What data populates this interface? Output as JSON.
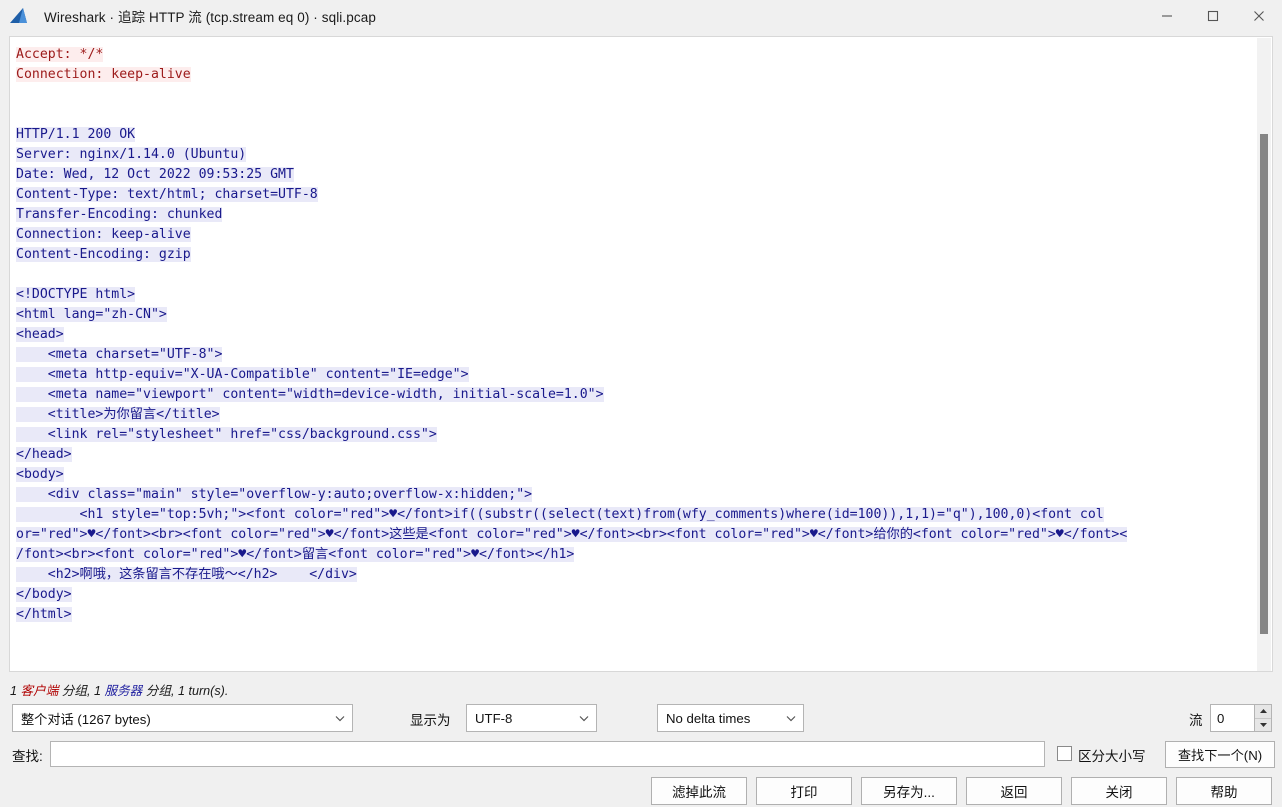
{
  "window": {
    "title": "Wireshark · 追踪 HTTP 流 (tcp.stream eq 0) · sqli.pcap",
    "logo_icon": "wireshark-shark-fin-logo",
    "minimize_icon": "minimize-icon",
    "maximize_icon": "maximize-icon",
    "close_icon": "close-icon"
  },
  "stream": {
    "lines": [
      {
        "dir": "req",
        "text": "Accept: */*"
      },
      {
        "dir": "req",
        "text": "Connection: keep-alive"
      },
      {
        "dir": "blank",
        "text": ""
      },
      {
        "dir": "blank",
        "text": ""
      },
      {
        "dir": "resp",
        "text": "HTTP/1.1 200 OK"
      },
      {
        "dir": "resp",
        "text": "Server: nginx/1.14.0 (Ubuntu)"
      },
      {
        "dir": "resp",
        "text": "Date: Wed, 12 Oct 2022 09:53:25 GMT"
      },
      {
        "dir": "resp",
        "text": "Content-Type: text/html; charset=UTF-8"
      },
      {
        "dir": "resp",
        "text": "Transfer-Encoding: chunked"
      },
      {
        "dir": "resp",
        "text": "Connection: keep-alive"
      },
      {
        "dir": "resp",
        "text": "Content-Encoding: gzip"
      },
      {
        "dir": "blank",
        "text": ""
      },
      {
        "dir": "resp",
        "text": "<!DOCTYPE html>"
      },
      {
        "dir": "resp",
        "text": "<html lang=\"zh-CN\">"
      },
      {
        "dir": "resp",
        "text": "<head>"
      },
      {
        "dir": "resp",
        "text": "    <meta charset=\"UTF-8\">"
      },
      {
        "dir": "resp",
        "text": "    <meta http-equiv=\"X-UA-Compatible\" content=\"IE=edge\">"
      },
      {
        "dir": "resp",
        "text": "    <meta name=\"viewport\" content=\"width=device-width, initial-scale=1.0\">"
      },
      {
        "dir": "resp",
        "text": "    <title>为你留言</title>"
      },
      {
        "dir": "resp",
        "text": "    <link rel=\"stylesheet\" href=\"css/background.css\">"
      },
      {
        "dir": "resp",
        "text": "</head>"
      },
      {
        "dir": "resp",
        "text": "<body>"
      },
      {
        "dir": "resp",
        "text": "    <div class=\"main\" style=\"overflow-y:auto;overflow-x:hidden;\">"
      },
      {
        "dir": "resp",
        "text": "        <h1 style=\"top:5vh;\"><font color=\"red\">♥</font>if((substr((select(text)from(wfy_comments)where(id=100)),1,1)=\"q\"),100,0)<font col"
      },
      {
        "dir": "resp",
        "text": "or=\"red\">♥</font><br><font color=\"red\">♥</font>这些是<font color=\"red\">♥</font><br><font color=\"red\">♥</font>给你的<font color=\"red\">♥</font><"
      },
      {
        "dir": "resp",
        "text": "/font><br><font color=\"red\">♥</font>留言<font color=\"red\">♥</font></h1>"
      },
      {
        "dir": "resp",
        "text": "    <h2>啊哦，这条留言不存在哦～</h2>    </div>"
      },
      {
        "dir": "resp",
        "text": "</body>"
      },
      {
        "dir": "resp",
        "text": "</html>"
      }
    ],
    "scrollbar": "vertical-scrollbar"
  },
  "status": {
    "prefix": "1 ",
    "client_word": "客户端",
    "middle": " 分组, 1 ",
    "server_word": "服务器",
    "suffix": " 分组, 1 turn(s)."
  },
  "options": {
    "conversation_value": "整个对话 (1267 bytes)",
    "show_as_label": "显示为",
    "charset_value": "UTF-8",
    "delta_value": "No delta times",
    "stream_label": "流",
    "stream_value": "0"
  },
  "find": {
    "label": "查找:",
    "value": "",
    "placeholder": "",
    "case_sensitive_label": "区分大小写",
    "case_sensitive_checked": false,
    "find_next_label": "查找下一个(N)"
  },
  "buttons": [
    {
      "label": "滤掉此流",
      "name": "filter-out-stream-button"
    },
    {
      "label": "打印",
      "name": "print-button"
    },
    {
      "label": "另存为...",
      "name": "save-as-button"
    },
    {
      "label": "返回",
      "name": "back-button"
    },
    {
      "label": "关闭",
      "name": "close-button"
    },
    {
      "label": "帮助",
      "name": "help-button"
    }
  ],
  "colors": {
    "request_text": "#9c1a1a",
    "request_bg": "#fdeded",
    "response_text": "#19198c",
    "response_bg": "#e9e9f8",
    "window_bg": "#f0f0f0"
  }
}
